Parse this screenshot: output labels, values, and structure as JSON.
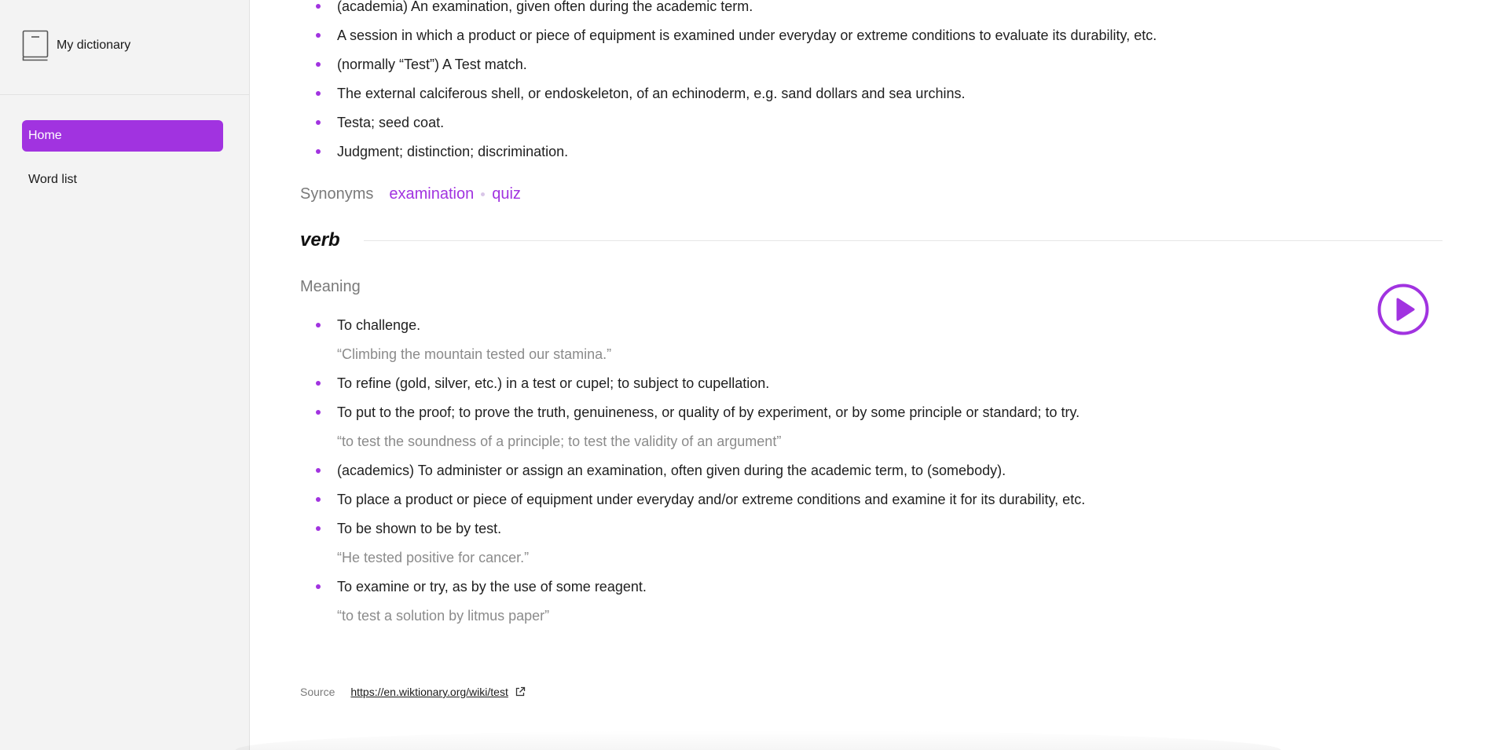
{
  "app": {
    "title": "My dictionary"
  },
  "sidebar": {
    "items": [
      {
        "label": "Home",
        "active": true
      },
      {
        "label": "Word list",
        "active": false
      }
    ]
  },
  "noun_definitions": [
    {
      "text": "(academia) An examination, given often during the academic term."
    },
    {
      "text": "A session in which a product or piece of equipment is examined under everyday or extreme conditions to evaluate its durability, etc."
    },
    {
      "text": "(normally “Test”) A Test match."
    },
    {
      "text": "The external calciferous shell, or endoskeleton, of an echinoderm, e.g. sand dollars and sea urchins."
    },
    {
      "text": "Testa; seed coat."
    },
    {
      "text": "Judgment; distinction; discrimination."
    }
  ],
  "synonyms": {
    "label": "Synonyms",
    "items": [
      "examination",
      "quiz"
    ]
  },
  "verb": {
    "part_of_speech": "verb",
    "meaning_label": "Meaning",
    "definitions": [
      {
        "text": "To challenge.",
        "example": "“Climbing the mountain tested our stamina.”"
      },
      {
        "text": "To refine (gold, silver, etc.) in a test or cupel; to subject to cupellation.",
        "example": ""
      },
      {
        "text": "To put to the proof; to prove the truth, genuineness, or quality of by experiment, or by some principle or standard; to try.",
        "example": "“to test the soundness of a principle; to test the validity of an argument”"
      },
      {
        "text": "(academics) To administer or assign an examination, often given during the academic term, to (somebody).",
        "example": ""
      },
      {
        "text": "To place a product or piece of equipment under everyday and/or extreme conditions and examine it for its durability, etc.",
        "example": ""
      },
      {
        "text": "To be shown to be by test.",
        "example": "“He tested positive for cancer.”"
      },
      {
        "text": "To examine or try, as by the use of some reagent.",
        "example": "“to test a solution by litmus paper”"
      }
    ]
  },
  "source": {
    "label": "Source",
    "url": "https://en.wiktionary.org/wiki/test"
  },
  "colors": {
    "accent": "#a133e0",
    "sidebar_bg": "#f3f3f3",
    "muted_text": "#8b8b8b"
  },
  "icons": {
    "brand": "book-icon",
    "play": "play-circle-icon",
    "external": "external-link-icon"
  }
}
